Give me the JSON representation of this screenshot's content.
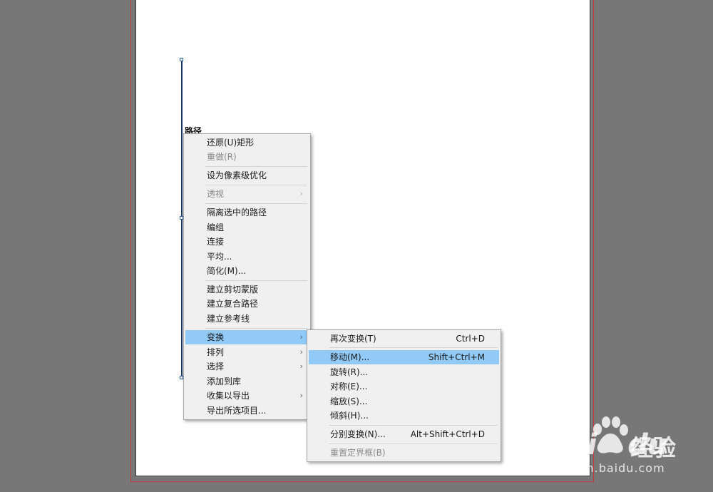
{
  "canvas": {
    "path_label": "路径"
  },
  "context_menu": [
    {
      "label": "还原(U)矩形",
      "disabled": false,
      "submenu": false
    },
    {
      "label": "重做(R)",
      "disabled": true,
      "submenu": false
    },
    {
      "label": "设为像素级优化",
      "disabled": false,
      "submenu": false
    },
    {
      "label": "透视",
      "disabled": true,
      "submenu": true
    },
    {
      "label": "隔离选中的路径",
      "disabled": false,
      "submenu": false
    },
    {
      "label": "编组",
      "disabled": false,
      "submenu": false
    },
    {
      "label": "连接",
      "disabled": false,
      "submenu": false
    },
    {
      "label": "平均...",
      "disabled": false,
      "submenu": false
    },
    {
      "label": "简化(M)...",
      "disabled": false,
      "submenu": false
    },
    {
      "label": "建立剪切蒙版",
      "disabled": false,
      "submenu": false
    },
    {
      "label": "建立复合路径",
      "disabled": false,
      "submenu": false
    },
    {
      "label": "建立参考线",
      "disabled": false,
      "submenu": false
    },
    {
      "label": "变换",
      "disabled": false,
      "submenu": true,
      "highlighted": true
    },
    {
      "label": "排列",
      "disabled": false,
      "submenu": true
    },
    {
      "label": "选择",
      "disabled": false,
      "submenu": true
    },
    {
      "label": "添加到库",
      "disabled": false,
      "submenu": false
    },
    {
      "label": "收集以导出",
      "disabled": false,
      "submenu": true
    },
    {
      "label": "导出所选项目...",
      "disabled": false,
      "submenu": false
    }
  ],
  "transform_submenu": [
    {
      "label": "再次变换(T)",
      "shortcut": "Ctrl+D",
      "disabled": false
    },
    {
      "label": "移动(M)...",
      "shortcut": "Shift+Ctrl+M",
      "disabled": false,
      "highlighted": true
    },
    {
      "label": "旋转(R)...",
      "shortcut": "",
      "disabled": false
    },
    {
      "label": "对称(E)...",
      "shortcut": "",
      "disabled": false
    },
    {
      "label": "缩放(S)...",
      "shortcut": "",
      "disabled": false
    },
    {
      "label": "倾斜(H)...",
      "shortcut": "",
      "disabled": false
    },
    {
      "label": "分别变换(N)...",
      "shortcut": "Alt+Shift+Ctrl+D",
      "disabled": false
    },
    {
      "label": "重置定界框(B)",
      "shortcut": "",
      "disabled": true
    }
  ],
  "submenu_arrow": "›",
  "watermark": {
    "brand_latin": "Bai",
    "brand_du": "du",
    "brand_cn": "经验",
    "url": "jingyan.baidu.com"
  },
  "colors": {
    "highlight": "#91c9f7",
    "workspace": "#777777",
    "artboard_border": "#c0393b"
  }
}
